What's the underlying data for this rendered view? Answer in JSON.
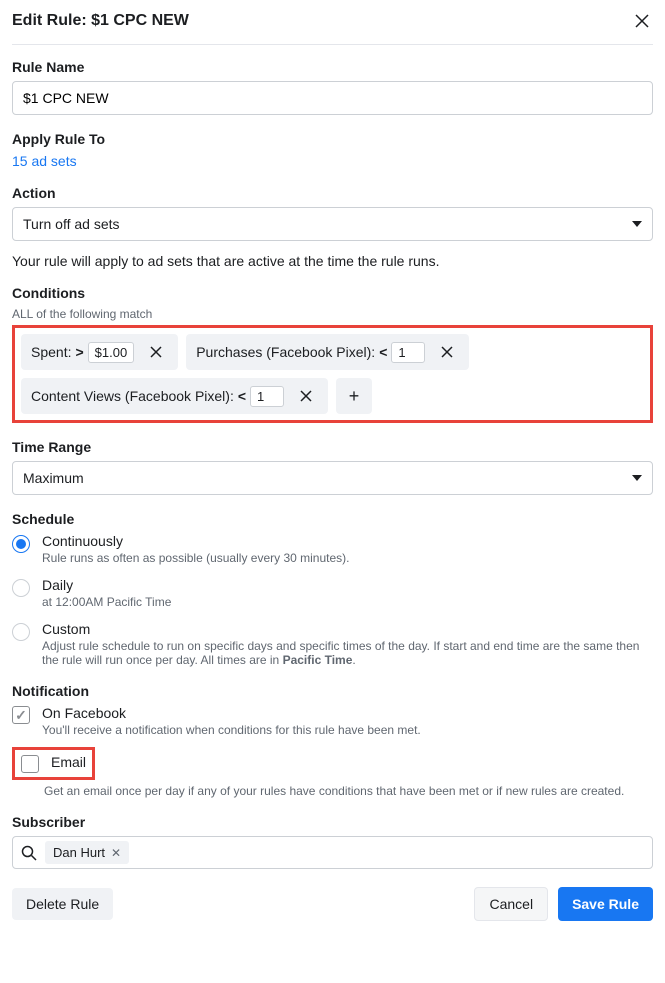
{
  "header": {
    "title": "Edit Rule: $1 CPC NEW"
  },
  "ruleName": {
    "label": "Rule Name",
    "value": "$1 CPC NEW"
  },
  "applyTo": {
    "label": "Apply Rule To",
    "link": "15 ad sets"
  },
  "action": {
    "label": "Action",
    "selected": "Turn off ad sets",
    "help": "Your rule will apply to ad sets that are active at the time the rule runs."
  },
  "conditions": {
    "label": "Conditions",
    "sub": "ALL of the following match",
    "items": [
      {
        "field": "Spent:",
        "op": ">",
        "value": "$1.00"
      },
      {
        "field": "Purchases (Facebook Pixel):",
        "op": "<",
        "value": "1"
      },
      {
        "field": "Content Views (Facebook Pixel):",
        "op": "<",
        "value": "1"
      }
    ]
  },
  "timeRange": {
    "label": "Time Range",
    "selected": "Maximum"
  },
  "schedule": {
    "label": "Schedule",
    "options": [
      {
        "title": "Continuously",
        "desc": "Rule runs as often as possible (usually every 30 minutes).",
        "checked": true
      },
      {
        "title": "Daily",
        "desc": "at 12:00AM Pacific Time",
        "checked": false
      },
      {
        "title": "Custom",
        "desc_pre": "Adjust rule schedule to run on specific days and specific times of the day. If start and end time are the same then the rule will run once per day. All times are in ",
        "desc_bold": "Pacific Time",
        "desc_post": ".",
        "checked": false
      }
    ]
  },
  "notification": {
    "label": "Notification",
    "facebook": {
      "title": "On Facebook",
      "desc": "You'll receive a notification when conditions for this rule have been met.",
      "checked": true
    },
    "email": {
      "title": "Email",
      "desc": "Get an email once per day if any of your rules have conditions that have been met or if new rules are created.",
      "checked": false
    }
  },
  "subscriber": {
    "label": "Subscriber",
    "token": "Dan Hurt"
  },
  "footer": {
    "delete": "Delete Rule",
    "cancel": "Cancel",
    "save": "Save Rule"
  }
}
